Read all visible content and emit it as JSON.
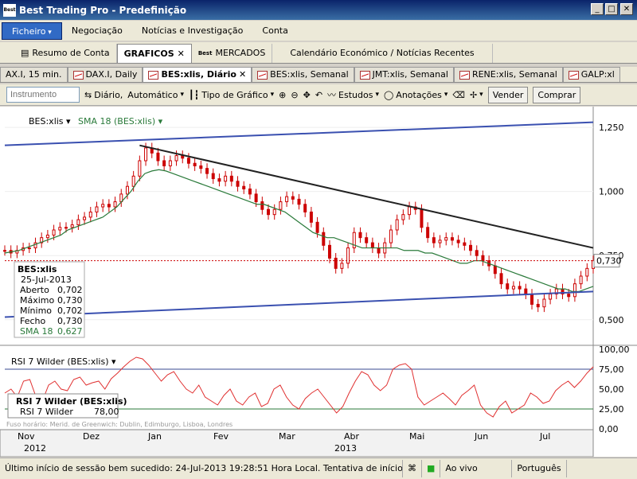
{
  "window": {
    "title": "Best Trading Pro - Predefinição",
    "logo": "Best",
    "min": "_",
    "max": "□",
    "close": "✕"
  },
  "menu": [
    "Ficheiro",
    "Negociação",
    "Notícias e Investigação",
    "Conta"
  ],
  "main_tabs": [
    "Resumo de Conta",
    "GRAFICOS",
    "MERCADOS",
    "Calendário Económico / Notícias Recentes"
  ],
  "main_tabs_extra": {
    "close": "✕",
    "best_logo": "Best"
  },
  "chart_tabs": [
    "AX.I, 15 min.",
    "DAX.I, Daily",
    "BES:xlis, Diário",
    "BES:xlis, Semanal",
    "JMT:xlis, Semanal",
    "RENE:xlis, Semanal",
    "GALP:xl"
  ],
  "toolbar": {
    "instrument_placeholder": "Instrumento",
    "period": "Diário,",
    "mode": "Automático",
    "chart_type": "Tipo de Gráfico",
    "studies": "Estudos",
    "annotations": "Anotações",
    "sell": "Vender",
    "buy": "Comprar"
  },
  "chart_data": {
    "type": "candlestick",
    "instrument": "BES:xlis",
    "indicator": "SMA 18 (BES:xlis)",
    "last_price_label": "0,730",
    "y_ticks": [
      "1,250",
      "1,000",
      "0,750",
      "0,500"
    ],
    "ylim": [
      0.4,
      1.3
    ],
    "x_months": [
      "Nov",
      "Dez",
      "Jan",
      "Fev",
      "Mar",
      "Abr",
      "Mai",
      "Jun",
      "Jul"
    ],
    "x_years": [
      "2012",
      "2013"
    ],
    "info_panel": {
      "title": "BES:xlis",
      "date": "25-Jul-2013",
      "rows": [
        [
          "Aberto",
          "0,702"
        ],
        [
          "Máximo",
          "0,730"
        ],
        [
          "Mínimo",
          "0,702"
        ],
        [
          "Fecho",
          "0,730"
        ],
        [
          "SMA 18",
          "0,627"
        ]
      ]
    },
    "close_series": [
      0.77,
      0.76,
      0.77,
      0.78,
      0.78,
      0.8,
      0.82,
      0.83,
      0.85,
      0.86,
      0.86,
      0.87,
      0.89,
      0.9,
      0.92,
      0.94,
      0.95,
      0.94,
      0.96,
      0.99,
      1.02,
      1.06,
      1.12,
      1.17,
      1.15,
      1.12,
      1.1,
      1.12,
      1.14,
      1.13,
      1.11,
      1.1,
      1.09,
      1.07,
      1.05,
      1.04,
      1.06,
      1.04,
      1.02,
      1.01,
      0.99,
      0.96,
      0.93,
      0.91,
      0.93,
      0.96,
      0.98,
      0.97,
      0.95,
      0.92,
      0.88,
      0.84,
      0.79,
      0.74,
      0.7,
      0.72,
      0.78,
      0.84,
      0.82,
      0.8,
      0.78,
      0.76,
      0.8,
      0.85,
      0.89,
      0.91,
      0.94,
      0.93,
      0.86,
      0.82,
      0.8,
      0.81,
      0.82,
      0.81,
      0.8,
      0.79,
      0.77,
      0.75,
      0.73,
      0.71,
      0.68,
      0.64,
      0.62,
      0.63,
      0.62,
      0.6,
      0.56,
      0.55,
      0.58,
      0.6,
      0.62,
      0.6,
      0.59,
      0.64,
      0.67,
      0.7,
      0.73
    ],
    "sma_series": [
      0.76,
      0.765,
      0.77,
      0.78,
      0.79,
      0.8,
      0.81,
      0.82,
      0.83,
      0.85,
      0.86,
      0.87,
      0.88,
      0.89,
      0.9,
      0.92,
      0.94,
      0.97,
      1.0,
      1.04,
      1.07,
      1.08,
      1.085,
      1.08,
      1.07,
      1.06,
      1.05,
      1.04,
      1.03,
      1.02,
      1.01,
      1.0,
      0.99,
      0.98,
      0.97,
      0.96,
      0.95,
      0.95,
      0.94,
      0.93,
      0.92,
      0.9,
      0.88,
      0.86,
      0.84,
      0.83,
      0.82,
      0.82,
      0.81,
      0.8,
      0.79,
      0.78,
      0.78,
      0.78,
      0.78,
      0.78,
      0.78,
      0.77,
      0.77,
      0.77,
      0.76,
      0.76,
      0.75,
      0.74,
      0.73,
      0.72,
      0.72,
      0.73,
      0.73,
      0.72,
      0.71,
      0.7,
      0.69,
      0.68,
      0.67,
      0.66,
      0.65,
      0.64,
      0.63,
      0.62,
      0.62,
      0.61,
      0.61,
      0.62,
      0.63
    ],
    "trendlines": [
      {
        "from": [
          0,
          1.18
        ],
        "to": [
          96,
          1.27
        ],
        "color": "#3a50b0"
      },
      {
        "from": [
          0,
          0.51
        ],
        "to": [
          96,
          0.61
        ],
        "color": "#3a50b0"
      },
      {
        "from": [
          22,
          1.18
        ],
        "to": [
          96,
          0.78
        ],
        "color": "#222222"
      }
    ],
    "rsi": {
      "label": "RSI 7 Wilder (BES:xlis)",
      "panel_title": "RSI 7 Wilder (BES:xlis)",
      "value_label": "RSI 7 Wilder",
      "value": "78,00",
      "y_ticks": [
        "100,00",
        "75,00",
        "50,00",
        "25,00",
        "0,00"
      ],
      "levels": [
        75,
        25
      ],
      "series": [
        45,
        50,
        40,
        60,
        62,
        40,
        35,
        55,
        60,
        50,
        48,
        62,
        65,
        55,
        58,
        60,
        50,
        63,
        70,
        78,
        85,
        90,
        88,
        80,
        70,
        60,
        68,
        72,
        60,
        50,
        45,
        55,
        40,
        35,
        30,
        42,
        50,
        35,
        30,
        40,
        45,
        28,
        32,
        50,
        55,
        40,
        30,
        25,
        38,
        45,
        50,
        40,
        30,
        20,
        28,
        45,
        60,
        72,
        68,
        55,
        48,
        55,
        75,
        80,
        82,
        75,
        40,
        30,
        35,
        40,
        45,
        38,
        30,
        42,
        48,
        55,
        30,
        20,
        15,
        28,
        35,
        20,
        25,
        30,
        45,
        40,
        32,
        35,
        48,
        55,
        60,
        52,
        60,
        70,
        78
      ]
    },
    "timezone_note": "Fuso horário: Merid. de Greenwich: Dublin, Edimburgo, Lisboa, Londres"
  },
  "status": {
    "message": "Último início de sessão bem sucedido: 24-Jul-2013 19:28:51 Hora Local. Tentativa de início de sessã",
    "live": "Ao vivo",
    "language": "Português"
  }
}
